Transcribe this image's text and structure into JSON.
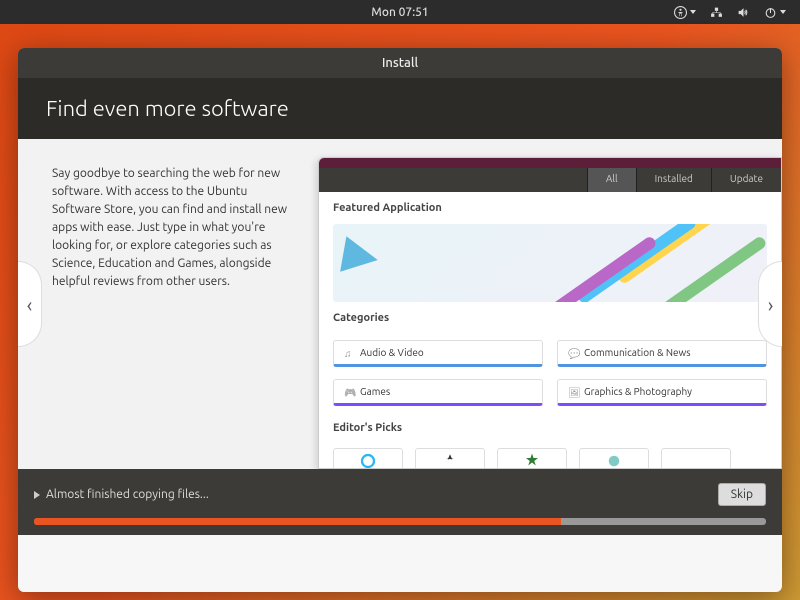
{
  "topbar": {
    "clock": "Mon 07:51"
  },
  "window": {
    "title": "Install"
  },
  "header": {
    "title": "Find even more software"
  },
  "description": "Say goodbye to searching the web for new software. With access to the Ubuntu Software Store, you can find and install new apps with ease. Just type in what you're looking for, or explore categories such as Science, Education and Games, alongside helpful reviews from other users.",
  "mock": {
    "tabs": {
      "all": "All",
      "installed": "Installed",
      "updates": "Update"
    },
    "featured": "Featured Application",
    "categories_label": "Categories",
    "categories": {
      "audio": "Audio & Video",
      "comm": "Communication & News",
      "games": "Games",
      "graphics": "Graphics & Photography"
    },
    "picks": "Editor's Picks"
  },
  "footer": {
    "status": "Almost finished copying files...",
    "skip": "Skip"
  },
  "nav": {
    "prev": "‹",
    "next": "›"
  }
}
